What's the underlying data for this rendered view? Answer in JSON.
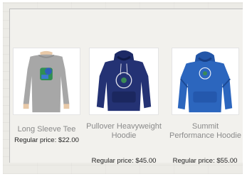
{
  "products": [
    {
      "title": "Long Sleeve Tee",
      "price": "Regular price: $22.00",
      "image_icon": "grey-long-sleeve-tee-image",
      "color": "#a8a8a8"
    },
    {
      "title": "Pullover Heavyweight Hoodie",
      "price": "Regular price: $45.00",
      "image_icon": "navy-pullover-hoodie-image",
      "color": "#22306e"
    },
    {
      "title": "Summit Performance Hoodie",
      "price": "Regular price: $55.00",
      "image_icon": "royal-blue-hoodie-image",
      "color": "#2a63b8"
    }
  ]
}
